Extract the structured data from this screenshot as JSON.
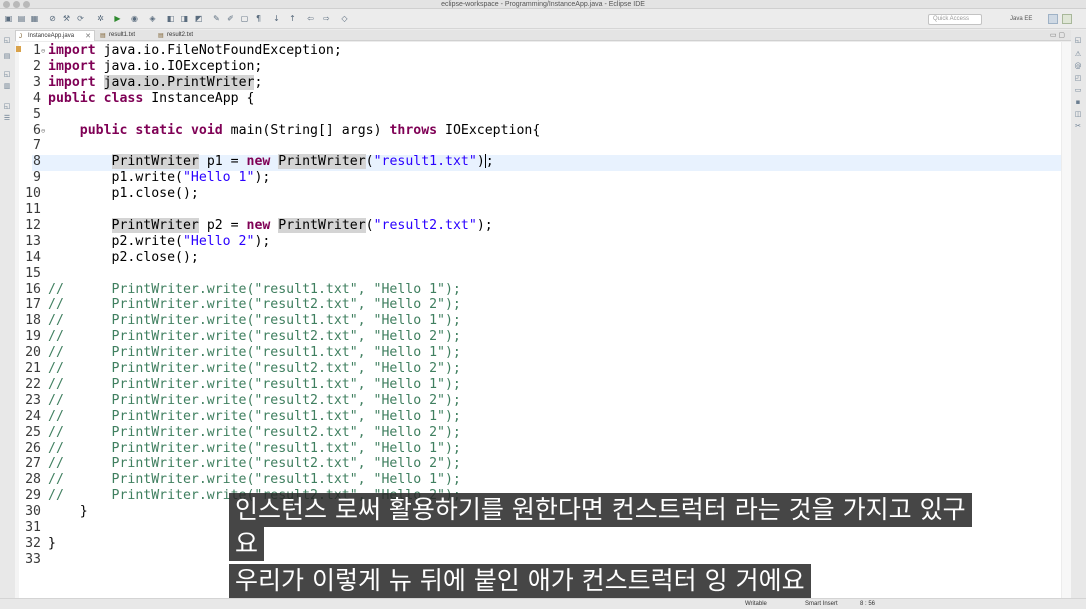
{
  "window": {
    "title": "eclipse-workspace - Programming/InstanceApp.java - Eclipse IDE"
  },
  "toolbar": {
    "quick_access_placeholder": "Quick Access",
    "perspective_label": "Java EE"
  },
  "editor_tabs": [
    {
      "label": "InstanceApp.java",
      "active": true
    },
    {
      "label": "result1.txt",
      "active": false
    },
    {
      "label": "result2.txt",
      "active": false
    }
  ],
  "code_lines": [
    {
      "n": "1",
      "fold": "⊖",
      "segs": [
        {
          "t": "import",
          "c": "kw"
        },
        {
          "t": " java.io.FileNotFoundException;"
        }
      ]
    },
    {
      "n": "2",
      "segs": [
        {
          "t": "import",
          "c": "kw"
        },
        {
          "t": " java.io.IOException;"
        }
      ]
    },
    {
      "n": "3",
      "segs": [
        {
          "t": "import",
          "c": "kw"
        },
        {
          "t": " "
        },
        {
          "t": "java.io.PrintWriter",
          "c": "occ"
        },
        {
          "t": ";"
        }
      ]
    },
    {
      "n": "4",
      "segs": [
        {
          "t": "public",
          "c": "kw"
        },
        {
          "t": " "
        },
        {
          "t": "class",
          "c": "kw"
        },
        {
          "t": " InstanceApp {"
        }
      ]
    },
    {
      "n": "5",
      "segs": []
    },
    {
      "n": "6",
      "fold": "⊖",
      "segs": [
        {
          "t": "    "
        },
        {
          "t": "public",
          "c": "kw"
        },
        {
          "t": " "
        },
        {
          "t": "static",
          "c": "kw"
        },
        {
          "t": " "
        },
        {
          "t": "void",
          "c": "kw"
        },
        {
          "t": " main(String[] args) "
        },
        {
          "t": "throws",
          "c": "kw"
        },
        {
          "t": " IOException{"
        }
      ]
    },
    {
      "n": "7",
      "segs": []
    },
    {
      "n": "8",
      "segs": [
        {
          "t": "        "
        },
        {
          "t": "PrintWriter",
          "c": "occ"
        },
        {
          "t": " p1 = "
        },
        {
          "t": "new",
          "c": "kw"
        },
        {
          "t": " "
        },
        {
          "t": "PrintWriter",
          "c": "occ"
        },
        {
          "t": "("
        },
        {
          "t": "\"result1.txt\"",
          "c": "str"
        },
        {
          "t": ")"
        },
        {
          "caret": true
        },
        {
          "t": ";"
        }
      ]
    },
    {
      "n": "9",
      "segs": [
        {
          "t": "        p1.write("
        },
        {
          "t": "\"Hello 1\"",
          "c": "str"
        },
        {
          "t": ");"
        }
      ]
    },
    {
      "n": "10",
      "segs": [
        {
          "t": "        p1.close();"
        }
      ]
    },
    {
      "n": "11",
      "segs": []
    },
    {
      "n": "12",
      "segs": [
        {
          "t": "        "
        },
        {
          "t": "PrintWriter",
          "c": "occ"
        },
        {
          "t": " p2 = "
        },
        {
          "t": "new",
          "c": "kw"
        },
        {
          "t": " "
        },
        {
          "t": "PrintWriter",
          "c": "occ"
        },
        {
          "t": "("
        },
        {
          "t": "\"result2.txt\"",
          "c": "str"
        },
        {
          "t": ");"
        }
      ]
    },
    {
      "n": "13",
      "segs": [
        {
          "t": "        p2.write("
        },
        {
          "t": "\"Hello 2\"",
          "c": "str"
        },
        {
          "t": ");"
        }
      ]
    },
    {
      "n": "14",
      "segs": [
        {
          "t": "        p2.close();"
        }
      ]
    },
    {
      "n": "15",
      "segs": []
    },
    {
      "n": "16",
      "segs": [
        {
          "t": "//      PrintWriter.write(\"result1.txt\", \"Hello 1\");",
          "c": "cmt"
        }
      ]
    },
    {
      "n": "17",
      "segs": [
        {
          "t": "//      PrintWriter.write(\"result2.txt\", \"Hello 2\");",
          "c": "cmt"
        }
      ]
    },
    {
      "n": "18",
      "segs": [
        {
          "t": "//      PrintWriter.write(\"result1.txt\", \"Hello 1\");",
          "c": "cmt"
        }
      ]
    },
    {
      "n": "19",
      "segs": [
        {
          "t": "//      PrintWriter.write(\"result2.txt\", \"Hello 2\");",
          "c": "cmt"
        }
      ]
    },
    {
      "n": "20",
      "segs": [
        {
          "t": "//      PrintWriter.write(\"result1.txt\", \"Hello 1\");",
          "c": "cmt"
        }
      ]
    },
    {
      "n": "21",
      "segs": [
        {
          "t": "//      PrintWriter.write(\"result2.txt\", \"Hello 2\");",
          "c": "cmt"
        }
      ]
    },
    {
      "n": "22",
      "segs": [
        {
          "t": "//      PrintWriter.write(\"result1.txt\", \"Hello 1\");",
          "c": "cmt"
        }
      ]
    },
    {
      "n": "23",
      "segs": [
        {
          "t": "//      PrintWriter.write(\"result2.txt\", \"Hello 2\");",
          "c": "cmt"
        }
      ]
    },
    {
      "n": "24",
      "segs": [
        {
          "t": "//      PrintWriter.write(\"result1.txt\", \"Hello 1\");",
          "c": "cmt"
        }
      ]
    },
    {
      "n": "25",
      "segs": [
        {
          "t": "//      PrintWriter.write(\"result2.txt\", \"Hello 2\");",
          "c": "cmt"
        }
      ]
    },
    {
      "n": "26",
      "segs": [
        {
          "t": "//      PrintWriter.write(\"result1.txt\", \"Hello 1\");",
          "c": "cmt"
        }
      ]
    },
    {
      "n": "27",
      "segs": [
        {
          "t": "//      PrintWriter.write(\"result2.txt\", \"Hello 2\");",
          "c": "cmt"
        }
      ]
    },
    {
      "n": "28",
      "segs": [
        {
          "t": "//      PrintWriter.write(\"result1.txt\", \"Hello 1\");",
          "c": "cmt"
        }
      ]
    },
    {
      "n": "29",
      "segs": [
        {
          "t": "//      PrintWriter.write(\"result2.txt\", \"Hello 2\");",
          "c": "cmt"
        }
      ]
    },
    {
      "n": "30",
      "segs": [
        {
          "t": "    }"
        }
      ]
    },
    {
      "n": "31",
      "segs": []
    },
    {
      "n": "32",
      "segs": [
        {
          "t": "}"
        }
      ]
    },
    {
      "n": "33",
      "segs": []
    }
  ],
  "subtitles": {
    "line1": "인스턴스 로써 활용하기를 원한다면 컨스트럭터 라는 것을 가지고 있구",
    "line2": "요",
    "line3": "우리가 이렇게 뉴 뒤에 붙인 애가 컨스트럭터 잉 거에요"
  },
  "status": {
    "writable": "Writable",
    "insert_mode": "Smart Insert",
    "position": "8 : 56"
  },
  "colors": {
    "keyword": "#7f0055",
    "string": "#2a00ff",
    "comment": "#3f7f5f",
    "current_line": "#e8f2fe",
    "occurrence": "#d4d4d4"
  }
}
